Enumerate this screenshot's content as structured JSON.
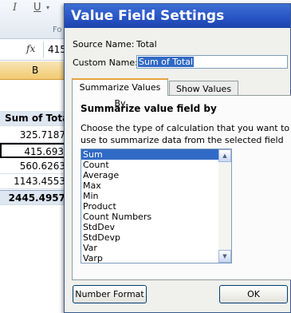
{
  "ribbon": {
    "italic_glyph": "I",
    "underline_glyph": "U",
    "dropdown_glyph": "▾",
    "group_label_fragment": "Fo"
  },
  "formula_bar": {
    "fx_label": "fx",
    "value": "415"
  },
  "column_header": {
    "label": "B"
  },
  "sheet": {
    "header": "Sum of Total",
    "values": [
      "325.7187",
      "415.693",
      "560.6263",
      "1143.4553"
    ],
    "grand_total": "2445.4957"
  },
  "dialog": {
    "title": "Value Field Settings",
    "source_name_label": "Source Name:",
    "source_name_value": "Total",
    "custom_name_label": "Custom Name:",
    "custom_name_value": "Sum of Total",
    "tabs": [
      {
        "label": "Summarize Values By",
        "active": true
      },
      {
        "label": "Show Values As",
        "active": false
      }
    ],
    "summarize_heading": "Summarize value field by",
    "description": "Choose the type of calculation that you want to use to summarize data from the selected field",
    "functions": [
      "Sum",
      "Count",
      "Average",
      "Max",
      "Min",
      "Product",
      "Count Numbers",
      "StdDev",
      "StdDevp",
      "Var",
      "Varp"
    ],
    "selected_function": "Sum",
    "scroll_up_glyph": "▲",
    "scroll_down_glyph": "▼",
    "number_format_label": "Number Format",
    "ok_label": "OK"
  }
}
